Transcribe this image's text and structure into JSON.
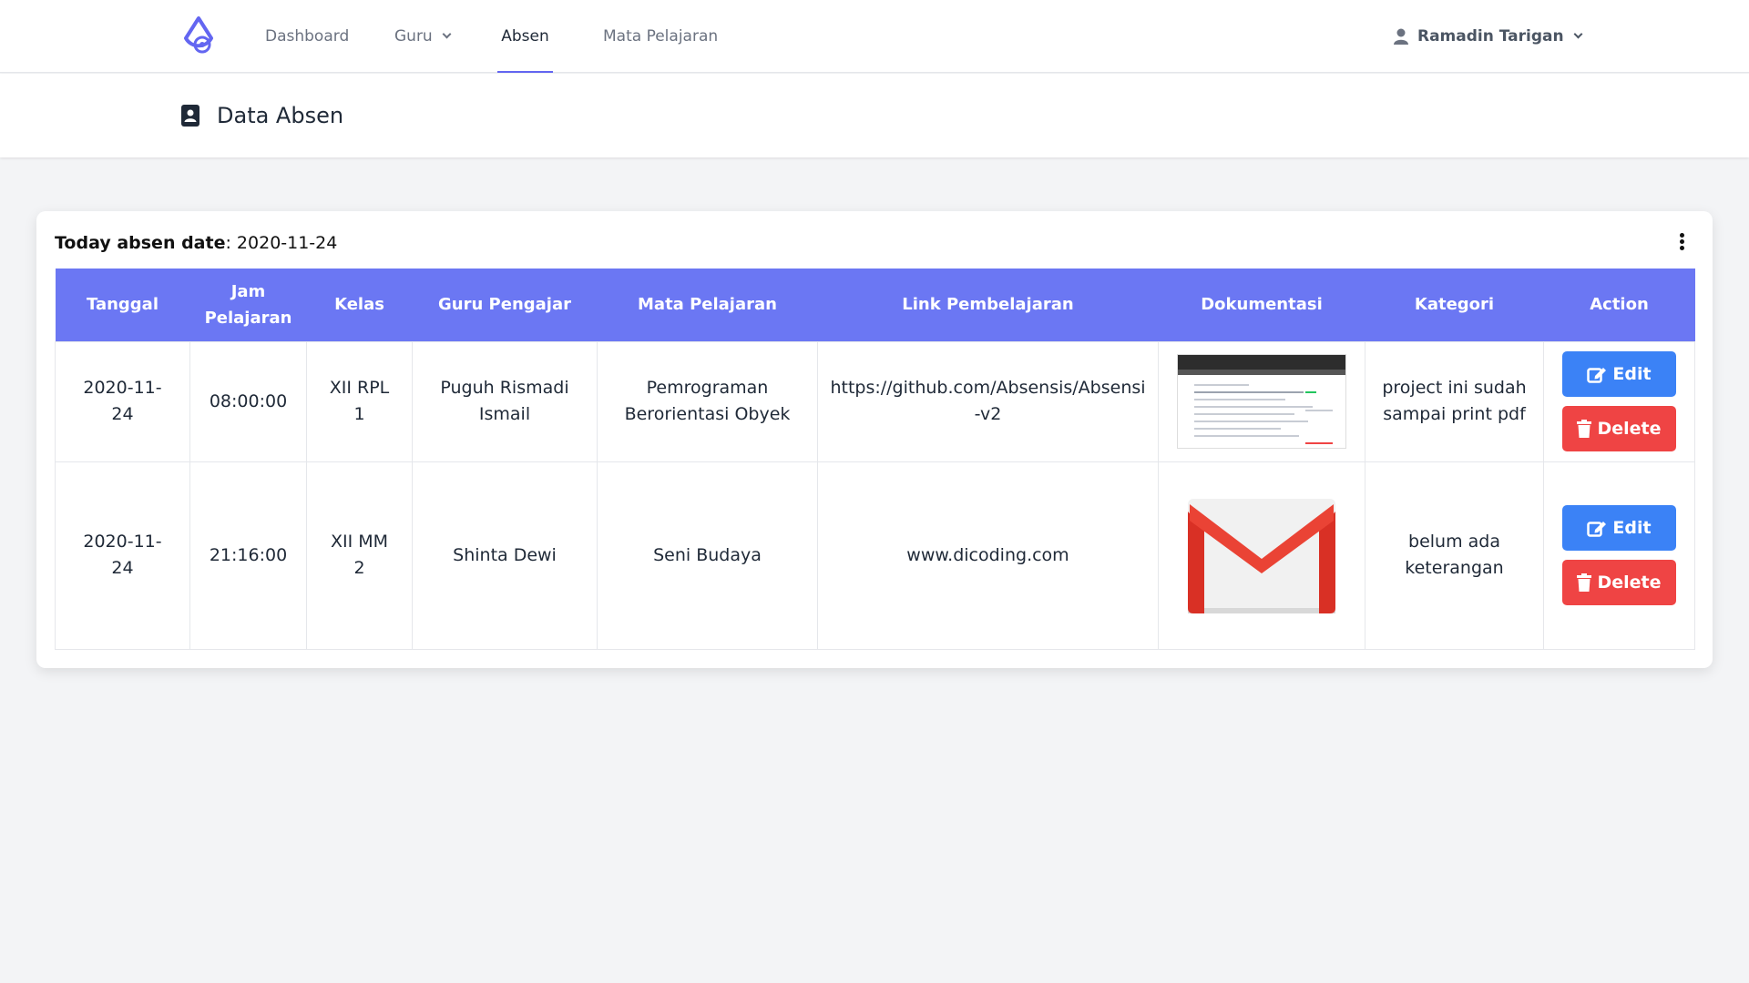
{
  "nav": {
    "items": [
      {
        "label": "Dashboard"
      },
      {
        "label": "Guru"
      },
      {
        "label": "Absen"
      },
      {
        "label": "Mata Pelajaran"
      }
    ],
    "user": "Ramadin Tarigan",
    "accent": "#6366f1"
  },
  "header": {
    "title": "Data Absen",
    "icon": "address-book-icon"
  },
  "card": {
    "today_label": "Today absen date",
    "today_value": ": 2020-11-24",
    "columns": [
      "Tanggal",
      "Jam Pelajaran",
      "Kelas",
      "Guru Pengajar",
      "Mata Pelajaran",
      "Link Pembelajaran",
      "Dokumentasi",
      "Kategori",
      "Action"
    ],
    "rows": [
      {
        "tanggal": "2020-11-24",
        "jam": "08:00:00",
        "kelas": "XII RPL 1",
        "guru": "Puguh Rismadi Ismail",
        "mapel": "Pemrograman Berorientasi Obyek",
        "link": "https://github.com/Absensis/Absensi-v2",
        "dokumentasi": "screenshot-thumbnail",
        "kategori": "project ini sudah sampai print pdf"
      },
      {
        "tanggal": "2020-11-24",
        "jam": "21:16:00",
        "kelas": "XII MM 2",
        "guru": "Shinta Dewi",
        "mapel": "Seni Budaya",
        "link": "www.dicoding.com",
        "dokumentasi": "gmail-logo",
        "kategori": "belum ada keterangan"
      }
    ],
    "edit_label": "Edit",
    "delete_label": "Delete",
    "colors": {
      "header": "#6b77f3",
      "edit": "#3b82f6",
      "delete": "#ef4444"
    }
  }
}
